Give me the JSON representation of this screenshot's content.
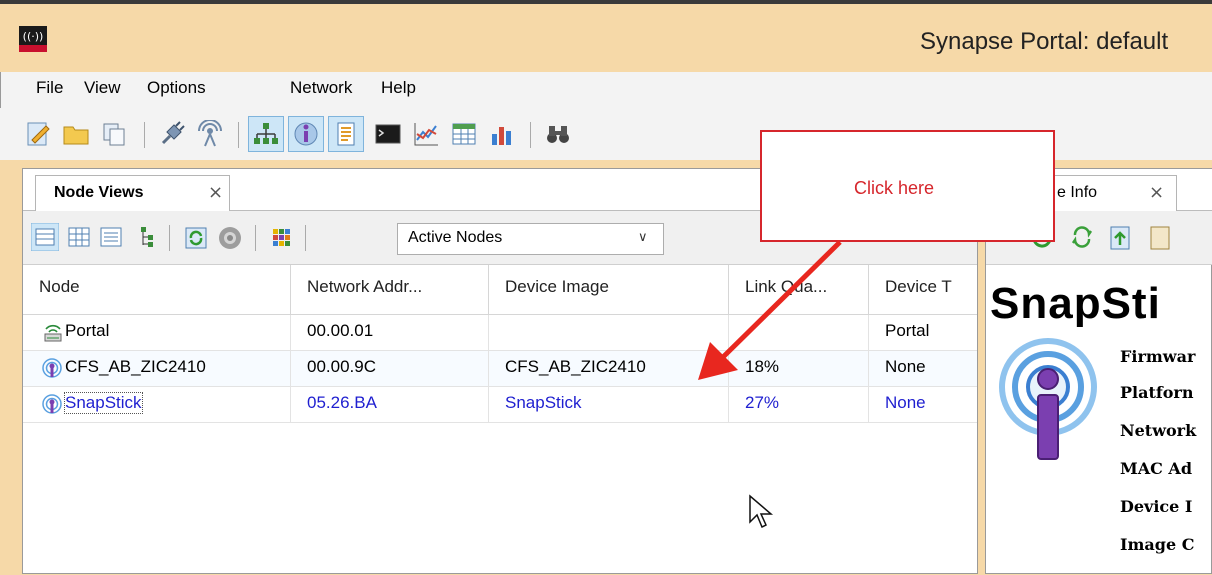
{
  "window": {
    "title": "Synapse Portal: default"
  },
  "menu": [
    "File",
    "View",
    "Options",
    "Network",
    "Help"
  ],
  "left_panel": {
    "tab_label": "Node Views",
    "tab_close": "×",
    "filter_select": {
      "value": "Active Nodes"
    },
    "columns": [
      "Node",
      "Network Addr...",
      "Device Image",
      "Link Qua...",
      "Device T"
    ],
    "rows": [
      {
        "node": "Portal",
        "address": "00.00.01",
        "image": "",
        "link": "",
        "type": "Portal",
        "icon": "portal-icon",
        "selected": false
      },
      {
        "node": "CFS_AB_ZIC2410",
        "address": "00.00.9C",
        "image": "CFS_AB_ZIC2410",
        "link": "18%",
        "type": "None",
        "icon": "wireless-node-icon",
        "selected": false
      },
      {
        "node": "SnapStick",
        "address": "05.26.BA",
        "image": "SnapStick",
        "link": "27%",
        "type": "None",
        "icon": "wireless-node-icon",
        "selected": true
      }
    ]
  },
  "right_panel": {
    "tab_label": "e Info",
    "tab_close": "×",
    "title": "SnapSti",
    "fields": [
      "Firmwar",
      "Platforn",
      "Network",
      "MAC Ad",
      "Device I",
      "Image C"
    ]
  },
  "callout": {
    "text": "Click here",
    "color": "#d6262c"
  },
  "colors": {
    "title_bar": "#f6d9a8",
    "selected_text": "#1f1fd0",
    "accent": "#7fb4dc"
  }
}
